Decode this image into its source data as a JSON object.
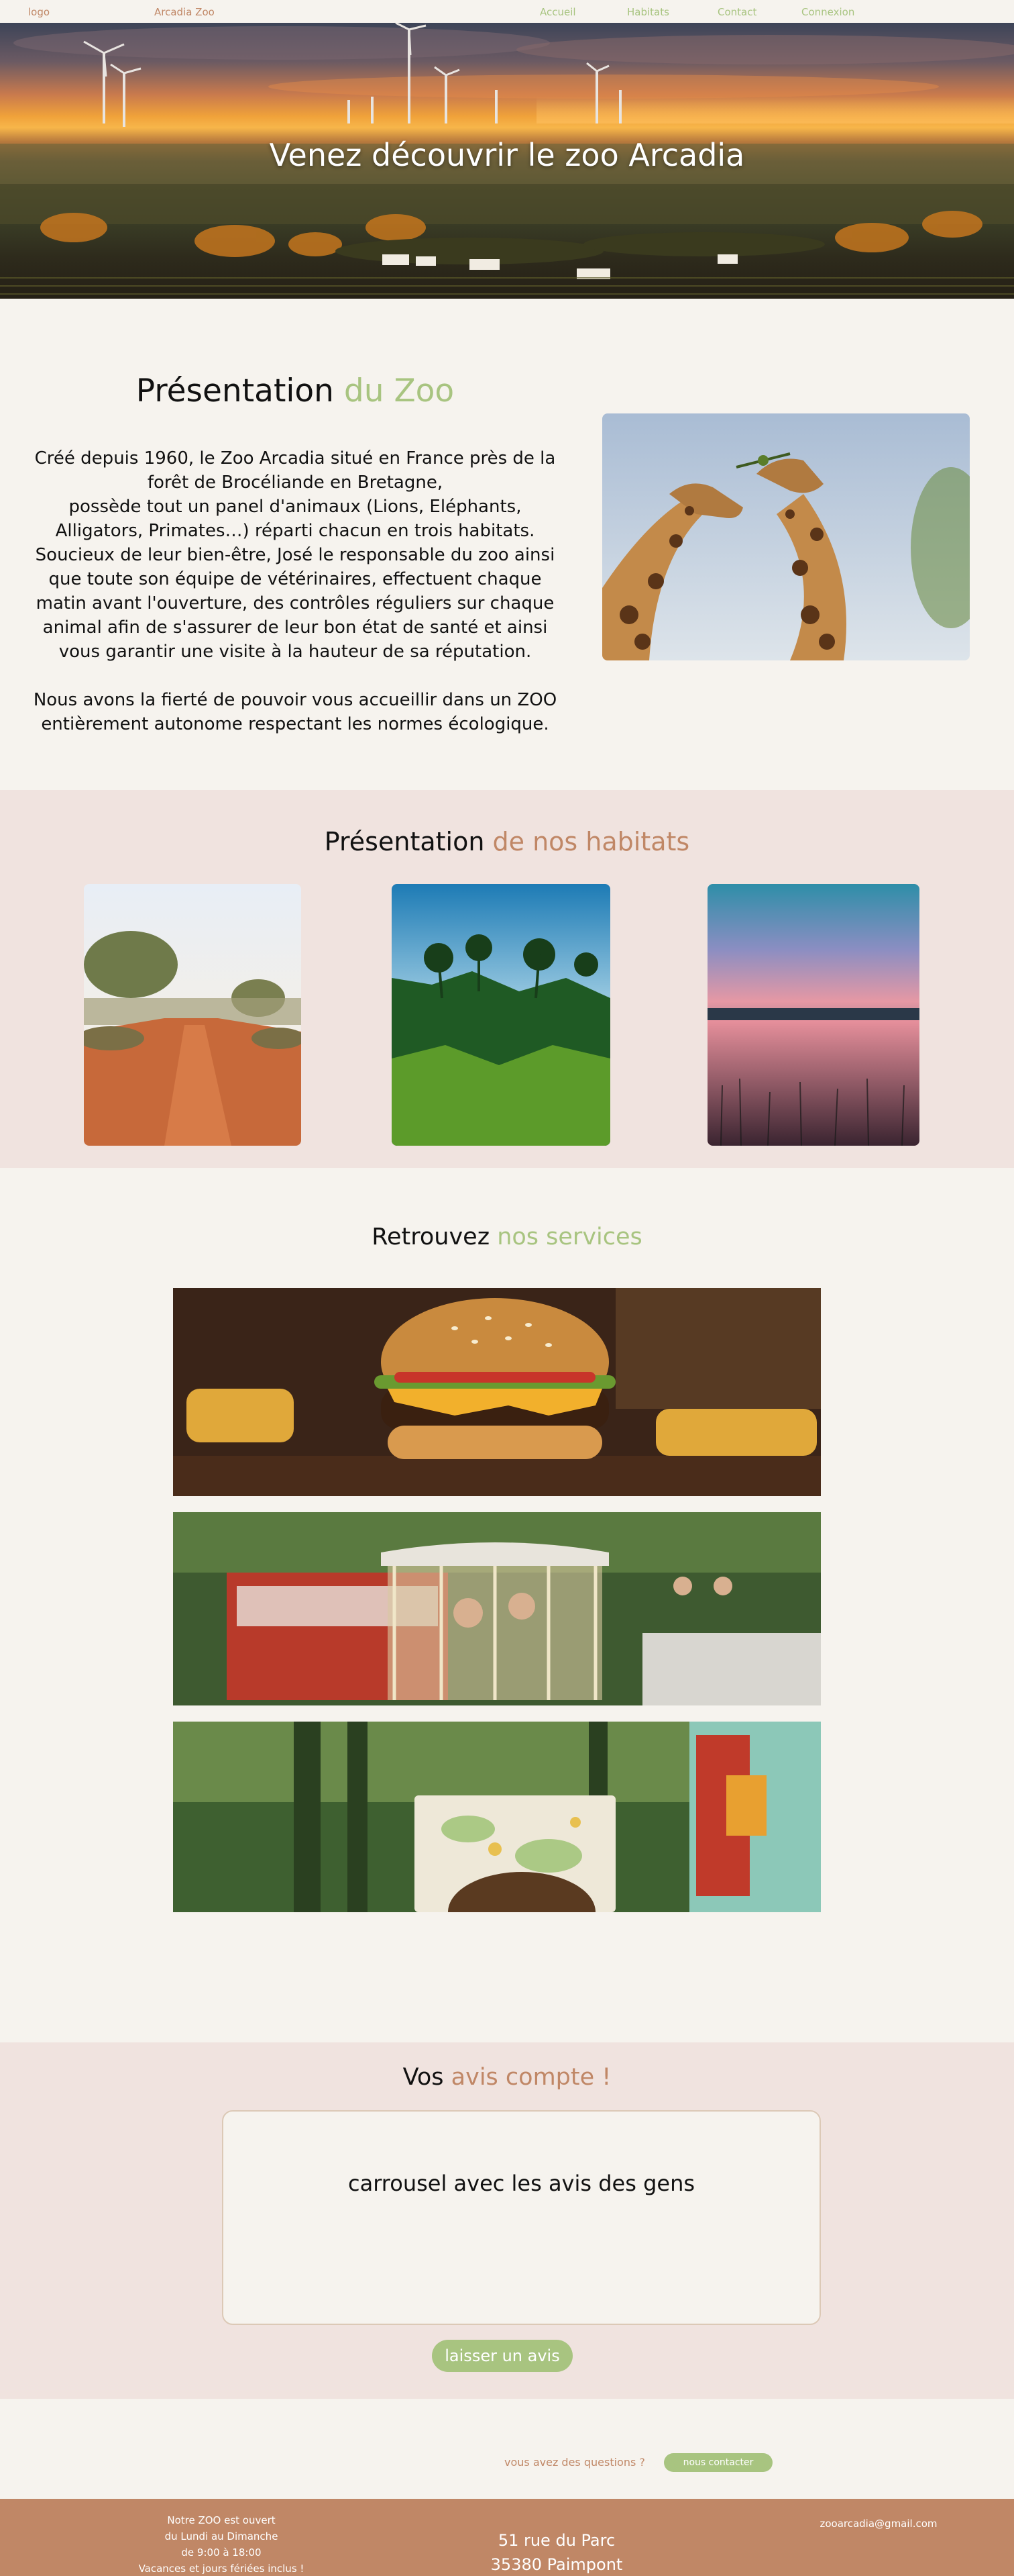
{
  "nav": {
    "logo": "logo",
    "brand": "Arcadia Zoo",
    "links": [
      "Accueil",
      "Habitats",
      "Contact",
      "Connexion"
    ]
  },
  "hero": {
    "title": "Venez découvrir le zoo Arcadia"
  },
  "presentation": {
    "title_main": "Présentation ",
    "title_accent": "du Zoo",
    "paragraphs": [
      "Créé depuis 1960, le Zoo Arcadia situé en France près de la forêt de Brocéliande en Bretagne,",
      "possède tout un panel d'animaux (Lions, Eléphants, Alligators, Primates…) réparti chacun en trois habitats.",
      "Soucieux de leur bien-être, José le responsable du zoo ainsi que toute son équipe de vétérinaires, effectuent chaque matin avant l'ouverture, des contrôles réguliers sur chaque animal afin de s'assurer de leur bon état de santé et ainsi vous garantir une visite à la hauteur de sa réputation.",
      "Nous avons la fierté de pouvoir vous accueillir dans un ZOO entièrement autonome respectant les normes écologique."
    ]
  },
  "habitats": {
    "title_main": "Présentation ",
    "title_accent": "de nos habitats"
  },
  "services": {
    "title_main": "Retrouvez ",
    "title_accent": "nos services"
  },
  "avis": {
    "title_main": "Vos ",
    "title_accent": "avis compte !",
    "carousel_text": "carrousel avec les avis des gens",
    "button": "laisser un avis"
  },
  "questions": {
    "label": "vous avez des questions ?",
    "button": "nous contacter"
  },
  "footer": {
    "hours": [
      "Notre ZOO est ouvert",
      "du Lundi au Dimanche",
      "de 9:00 à 18:00",
      "Vacances et jours fériées inclus !"
    ],
    "address": [
      "51 rue du Parc",
      "35380 Paimpont"
    ],
    "email": "zooarcadia@gmail.com"
  },
  "colors": {
    "background": "#f6f3ee",
    "accent_green": "#a8c480",
    "accent_brown": "#c08766",
    "section_pink": "#f0e3df"
  }
}
